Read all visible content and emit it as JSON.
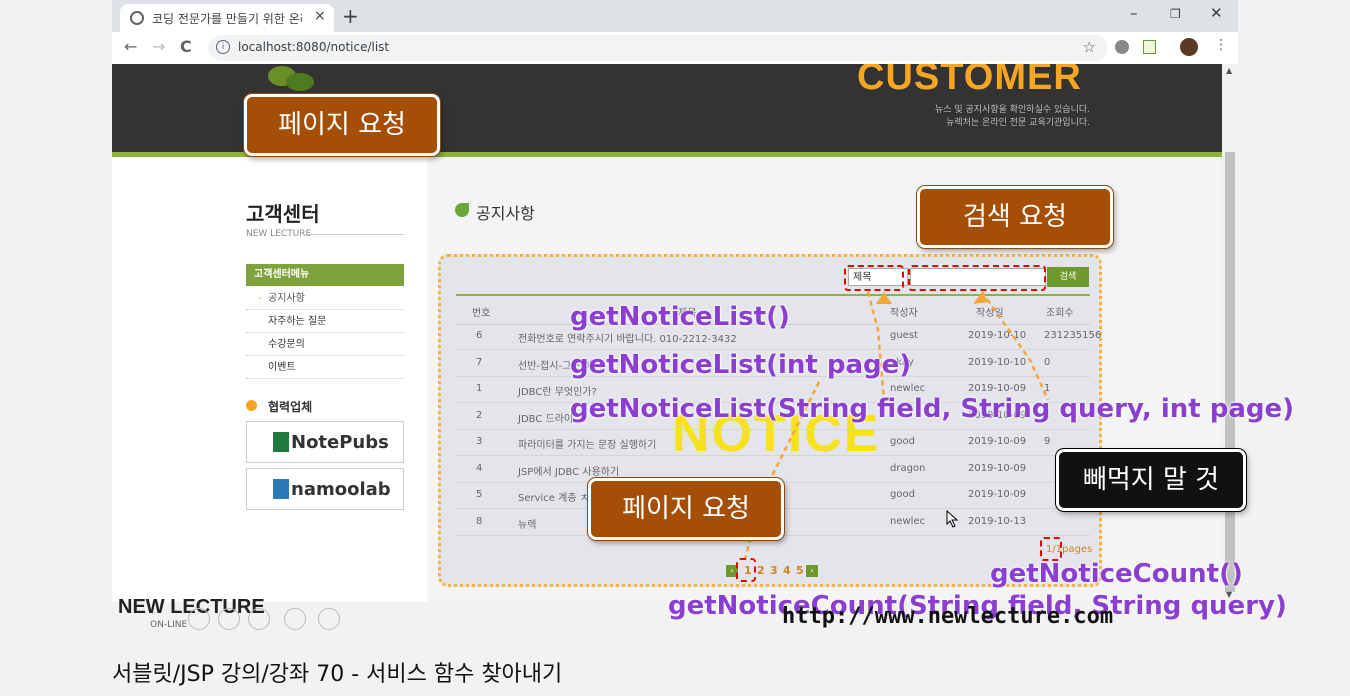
{
  "browser": {
    "tab_title": "코딩 전문가를 만들기 위한 온라",
    "tab_close": "×",
    "new_tab": "+",
    "minimize": "–",
    "restore": "❐",
    "close": "✕",
    "back": "←",
    "forward": "→",
    "reload": "C",
    "url": "localhost:8080/notice/list",
    "star": "☆"
  },
  "banner": {
    "title": "CUSTOMER",
    "sub1": "뉴스 및 공지사항을 확인하실수 있습니다.",
    "sub2": "뉴렉처는 온라인 전문 교육기관입니다."
  },
  "sidebar": {
    "title": "고객센터",
    "subtitle": "NEW LECTURE",
    "menu_head": "고객센터메뉴",
    "items": [
      {
        "label": "공지사항",
        "active": true
      },
      {
        "label": "자주하는 질문"
      },
      {
        "label": "수강문의"
      },
      {
        "label": "이벤트"
      }
    ],
    "partners_title": "협력업체",
    "partner1": "NotePubs",
    "partner2": "namoolab"
  },
  "notice": {
    "title": "공지사항",
    "search_field": "제목",
    "search_button": "검색",
    "columns": [
      "번호",
      "제목",
      "작성자",
      "작성일",
      "조회수"
    ],
    "rows": [
      {
        "no": "6",
        "title": "전화번호로 연락주시기 바랍니다. 010-2212-3432",
        "writer": "guest",
        "date": "2019-10-10",
        "hits": "231235156"
      },
      {
        "no": "7",
        "title": "선반-접시-그릇 하시",
        "writer": "okay",
        "date": "2019-10-10",
        "hits": "0"
      },
      {
        "no": "1",
        "title": "JDBC란 무엇인가?",
        "writer": "newlec",
        "date": "2019-10-09",
        "hits": "1"
      },
      {
        "no": "2",
        "title": "JDBC 드라이",
        "writer": "",
        "date": "2019-10-09",
        "hits": "1"
      },
      {
        "no": "3",
        "title": "파라미터를 가지는 문장 실행하기",
        "writer": "good",
        "date": "2019-10-09",
        "hits": "9"
      },
      {
        "no": "4",
        "title": "JSP에서 JDBC 사용하기",
        "writer": "dragon",
        "date": "2019-10-09",
        "hits": ""
      },
      {
        "no": "5",
        "title": "Service 계층 ㅊ",
        "writer": "good",
        "date": "2019-10-09",
        "hits": ""
      },
      {
        "no": "8",
        "title": "뉴렉",
        "writer": "newlec",
        "date": "2019-10-13",
        "hits": ""
      }
    ],
    "pages": [
      "1",
      "2",
      "3",
      "4",
      "5"
    ],
    "prev": "‹",
    "next": "›",
    "page_count": "1/1pages",
    "watermark": "NOTICE"
  },
  "annotations": {
    "page_request_top": "페이지 요청",
    "search_request": "검색 요청",
    "page_request_bottom": "페이지 요청",
    "dont_forget": "빼먹지 말 것",
    "fn1": "getNoticeList()",
    "fn2": "getNoticeList(int page)",
    "fn3": "getNoticeList(String field, String query, int page)",
    "fn4": "getNoticeCount()",
    "fn5": "getNoticeCount(String field, String query)"
  },
  "video": {
    "logo": "NEW LECTURE",
    "logo_sub": "ON-LINE",
    "url_watermark": "http://www.newlecture.com"
  },
  "caption": "서블릿/JSP 강의/강좌 70 - 서비스 함수 찾아내기"
}
